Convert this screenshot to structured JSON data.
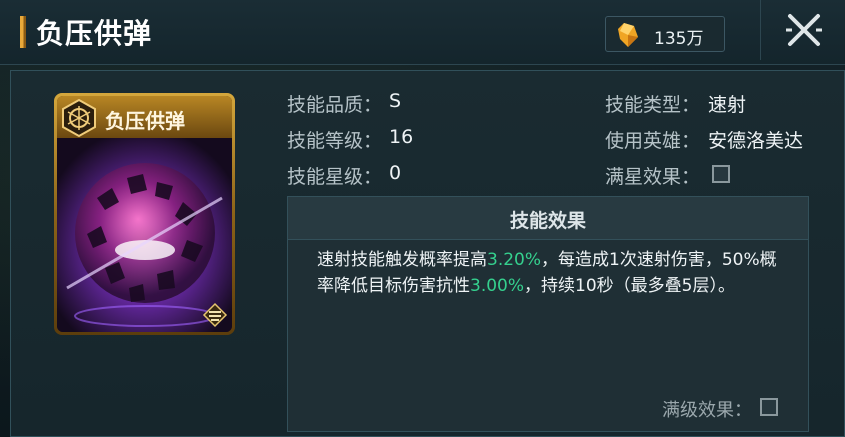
{
  "header": {
    "title": "负压供弹",
    "currency_amount": "135万"
  },
  "card": {
    "name": "负压供弹"
  },
  "stats": {
    "quality_label": "技能品质：",
    "quality_value": "S",
    "level_label": "技能等级：",
    "level_value": "16",
    "star_label": "技能星级：",
    "star_value": "0",
    "type_label": "技能类型：",
    "type_value": "速射",
    "hero_label": "使用英雄：",
    "hero_value": "安德洛美达",
    "max_star_label": "满星效果："
  },
  "effect": {
    "title": "技能效果",
    "text_1": "速射技能触发概率提高",
    "value_1": "3.20%",
    "text_2": "，每造成1次速射伤害，50%概率降低目标伤害抗性",
    "value_2": "3.00%",
    "text_3": "，持续10秒（最多叠5层）。",
    "max_level_label": "满级效果："
  },
  "colors": {
    "accent_gold": "#e9a93a",
    "highlight_green": "#35d08e"
  }
}
